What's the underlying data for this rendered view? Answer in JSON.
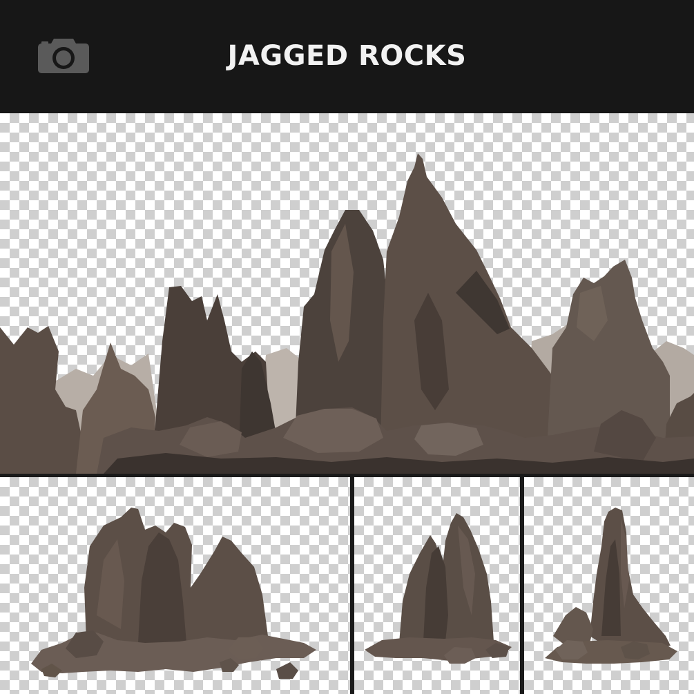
{
  "header": {
    "title": "JAGGED ROCKS",
    "icon": "camera-icon",
    "background": "#171717",
    "title_color": "#f2f2f2"
  },
  "preview": {
    "checker_light": "#ffffff",
    "checker_dark": "#cfcfcf",
    "rock_dark": "#3e3631",
    "rock_mid": "#5e5149",
    "rock_light": "#8a7d72",
    "rock_far": "#b8b0a8"
  }
}
